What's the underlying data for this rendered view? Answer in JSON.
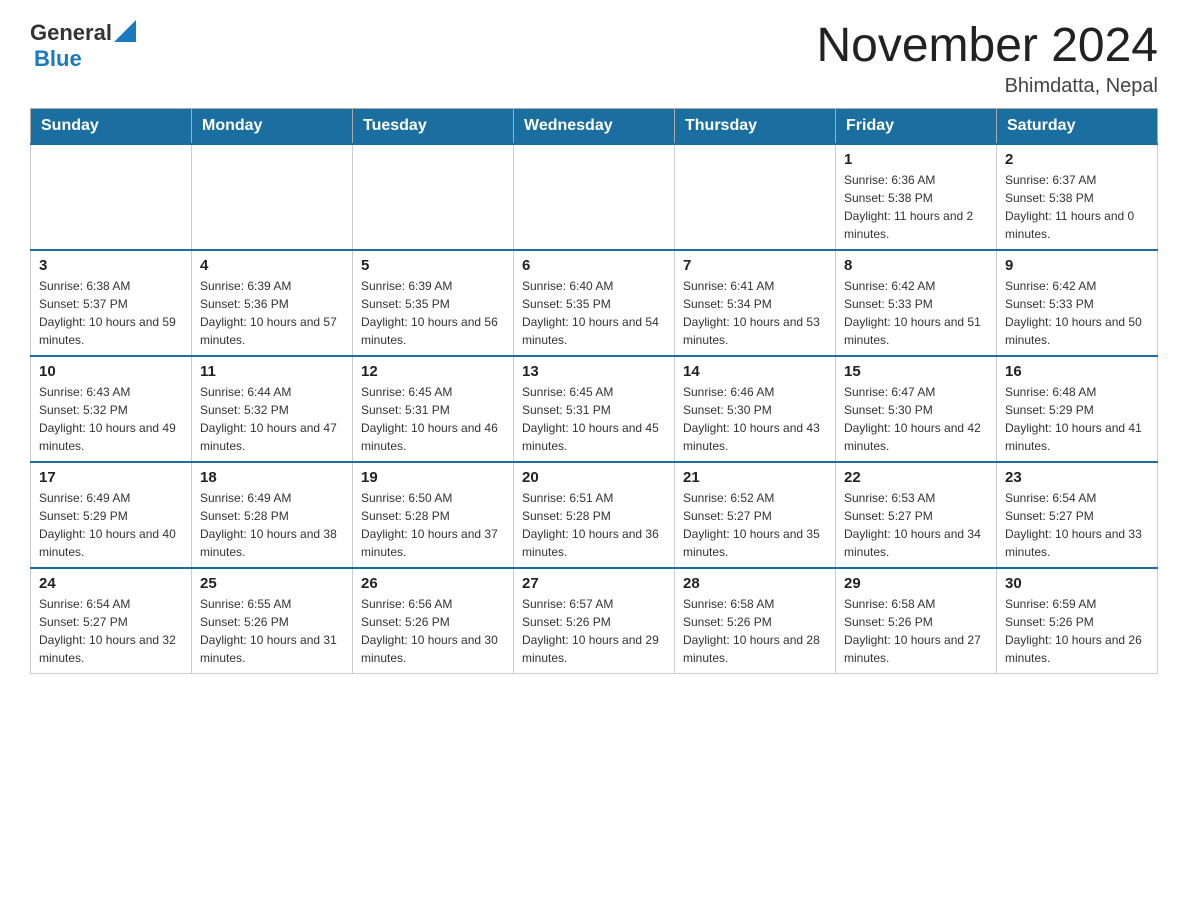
{
  "header": {
    "logo_general": "General",
    "logo_blue": "Blue",
    "month_year": "November 2024",
    "location": "Bhimdatta, Nepal"
  },
  "days_of_week": [
    "Sunday",
    "Monday",
    "Tuesday",
    "Wednesday",
    "Thursday",
    "Friday",
    "Saturday"
  ],
  "weeks": [
    {
      "days": [
        {
          "number": "",
          "info": ""
        },
        {
          "number": "",
          "info": ""
        },
        {
          "number": "",
          "info": ""
        },
        {
          "number": "",
          "info": ""
        },
        {
          "number": "",
          "info": ""
        },
        {
          "number": "1",
          "info": "Sunrise: 6:36 AM\nSunset: 5:38 PM\nDaylight: 11 hours and 2 minutes."
        },
        {
          "number": "2",
          "info": "Sunrise: 6:37 AM\nSunset: 5:38 PM\nDaylight: 11 hours and 0 minutes."
        }
      ]
    },
    {
      "days": [
        {
          "number": "3",
          "info": "Sunrise: 6:38 AM\nSunset: 5:37 PM\nDaylight: 10 hours and 59 minutes."
        },
        {
          "number": "4",
          "info": "Sunrise: 6:39 AM\nSunset: 5:36 PM\nDaylight: 10 hours and 57 minutes."
        },
        {
          "number": "5",
          "info": "Sunrise: 6:39 AM\nSunset: 5:35 PM\nDaylight: 10 hours and 56 minutes."
        },
        {
          "number": "6",
          "info": "Sunrise: 6:40 AM\nSunset: 5:35 PM\nDaylight: 10 hours and 54 minutes."
        },
        {
          "number": "7",
          "info": "Sunrise: 6:41 AM\nSunset: 5:34 PM\nDaylight: 10 hours and 53 minutes."
        },
        {
          "number": "8",
          "info": "Sunrise: 6:42 AM\nSunset: 5:33 PM\nDaylight: 10 hours and 51 minutes."
        },
        {
          "number": "9",
          "info": "Sunrise: 6:42 AM\nSunset: 5:33 PM\nDaylight: 10 hours and 50 minutes."
        }
      ]
    },
    {
      "days": [
        {
          "number": "10",
          "info": "Sunrise: 6:43 AM\nSunset: 5:32 PM\nDaylight: 10 hours and 49 minutes."
        },
        {
          "number": "11",
          "info": "Sunrise: 6:44 AM\nSunset: 5:32 PM\nDaylight: 10 hours and 47 minutes."
        },
        {
          "number": "12",
          "info": "Sunrise: 6:45 AM\nSunset: 5:31 PM\nDaylight: 10 hours and 46 minutes."
        },
        {
          "number": "13",
          "info": "Sunrise: 6:45 AM\nSunset: 5:31 PM\nDaylight: 10 hours and 45 minutes."
        },
        {
          "number": "14",
          "info": "Sunrise: 6:46 AM\nSunset: 5:30 PM\nDaylight: 10 hours and 43 minutes."
        },
        {
          "number": "15",
          "info": "Sunrise: 6:47 AM\nSunset: 5:30 PM\nDaylight: 10 hours and 42 minutes."
        },
        {
          "number": "16",
          "info": "Sunrise: 6:48 AM\nSunset: 5:29 PM\nDaylight: 10 hours and 41 minutes."
        }
      ]
    },
    {
      "days": [
        {
          "number": "17",
          "info": "Sunrise: 6:49 AM\nSunset: 5:29 PM\nDaylight: 10 hours and 40 minutes."
        },
        {
          "number": "18",
          "info": "Sunrise: 6:49 AM\nSunset: 5:28 PM\nDaylight: 10 hours and 38 minutes."
        },
        {
          "number": "19",
          "info": "Sunrise: 6:50 AM\nSunset: 5:28 PM\nDaylight: 10 hours and 37 minutes."
        },
        {
          "number": "20",
          "info": "Sunrise: 6:51 AM\nSunset: 5:28 PM\nDaylight: 10 hours and 36 minutes."
        },
        {
          "number": "21",
          "info": "Sunrise: 6:52 AM\nSunset: 5:27 PM\nDaylight: 10 hours and 35 minutes."
        },
        {
          "number": "22",
          "info": "Sunrise: 6:53 AM\nSunset: 5:27 PM\nDaylight: 10 hours and 34 minutes."
        },
        {
          "number": "23",
          "info": "Sunrise: 6:54 AM\nSunset: 5:27 PM\nDaylight: 10 hours and 33 minutes."
        }
      ]
    },
    {
      "days": [
        {
          "number": "24",
          "info": "Sunrise: 6:54 AM\nSunset: 5:27 PM\nDaylight: 10 hours and 32 minutes."
        },
        {
          "number": "25",
          "info": "Sunrise: 6:55 AM\nSunset: 5:26 PM\nDaylight: 10 hours and 31 minutes."
        },
        {
          "number": "26",
          "info": "Sunrise: 6:56 AM\nSunset: 5:26 PM\nDaylight: 10 hours and 30 minutes."
        },
        {
          "number": "27",
          "info": "Sunrise: 6:57 AM\nSunset: 5:26 PM\nDaylight: 10 hours and 29 minutes."
        },
        {
          "number": "28",
          "info": "Sunrise: 6:58 AM\nSunset: 5:26 PM\nDaylight: 10 hours and 28 minutes."
        },
        {
          "number": "29",
          "info": "Sunrise: 6:58 AM\nSunset: 5:26 PM\nDaylight: 10 hours and 27 minutes."
        },
        {
          "number": "30",
          "info": "Sunrise: 6:59 AM\nSunset: 5:26 PM\nDaylight: 10 hours and 26 minutes."
        }
      ]
    }
  ]
}
